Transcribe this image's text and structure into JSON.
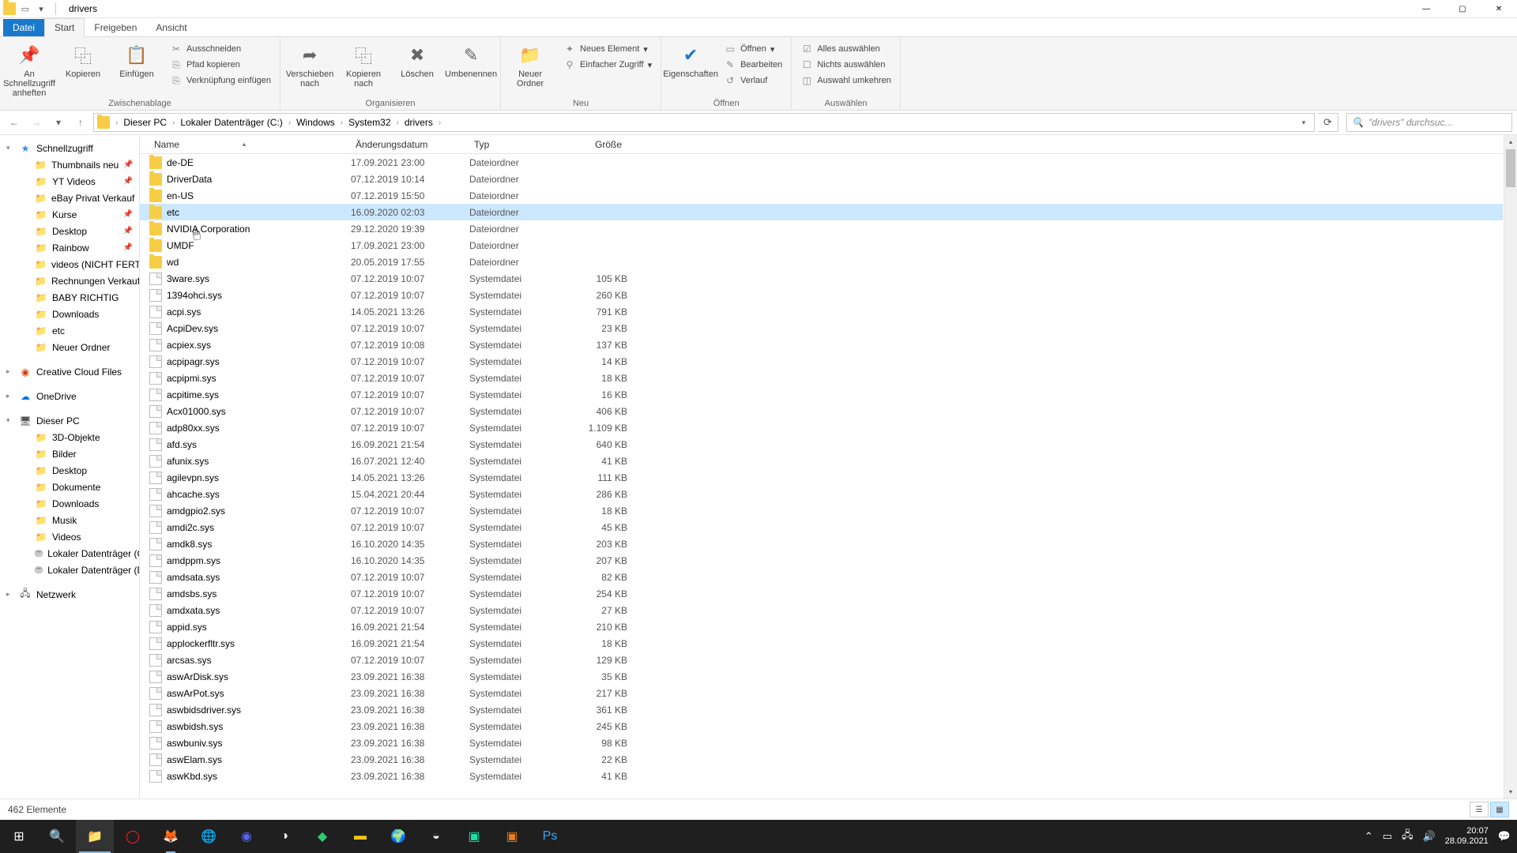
{
  "window": {
    "title": "drivers"
  },
  "tabs": {
    "file": "Datei",
    "start": "Start",
    "share": "Freigeben",
    "view": "Ansicht"
  },
  "ribbon": {
    "pin": "An Schnellzugriff\nanheften",
    "copy": "Kopieren",
    "paste": "Einfügen",
    "cut": "Ausschneiden",
    "copypath": "Pfad kopieren",
    "pastelnk": "Verknüpfung einfügen",
    "group_clipboard": "Zwischenablage",
    "moveto": "Verschieben\nnach",
    "copyto": "Kopieren\nnach",
    "delete": "Löschen",
    "rename": "Umbenennen",
    "group_organize": "Organisieren",
    "newfolder": "Neuer\nOrdner",
    "newitem": "Neues Element",
    "easyaccess": "Einfacher Zugriff",
    "group_new": "Neu",
    "properties": "Eigenschaften",
    "open": "Öffnen",
    "edit": "Bearbeiten",
    "history": "Verlauf",
    "group_open": "Öffnen",
    "selectall": "Alles auswählen",
    "selectnone": "Nichts auswählen",
    "invert": "Auswahl umkehren",
    "group_select": "Auswählen"
  },
  "breadcrumb": [
    "Dieser PC",
    "Lokaler Datenträger (C:)",
    "Windows",
    "System32",
    "drivers"
  ],
  "search_placeholder": "\"drivers\" durchsuc...",
  "sidebar": {
    "quick": "Schnellzugriff",
    "quick_items": [
      {
        "label": "Thumbnails neu",
        "pin": true
      },
      {
        "label": "YT Videos",
        "pin": true
      },
      {
        "label": "eBay Privat Verkauf",
        "pin": true
      },
      {
        "label": "Kurse",
        "pin": true
      },
      {
        "label": "Desktop",
        "pin": true
      },
      {
        "label": "Rainbow",
        "pin": true
      },
      {
        "label": "videos (NICHT FERTIG)",
        "pin": true
      },
      {
        "label": "Rechnungen Verkauf",
        "pin": true
      },
      {
        "label": "BABY RICHTIG",
        "pin": false
      },
      {
        "label": "Downloads",
        "pin": false
      },
      {
        "label": "etc",
        "pin": false
      },
      {
        "label": "Neuer Ordner",
        "pin": false
      }
    ],
    "cc": "Creative Cloud Files",
    "od": "OneDrive",
    "pc": "Dieser PC",
    "pc_items": [
      "3D-Objekte",
      "Bilder",
      "Desktop",
      "Dokumente",
      "Downloads",
      "Musik",
      "Videos",
      "Lokaler Datenträger (C:)",
      "Lokaler Datenträger (D:)"
    ],
    "net": "Netzwerk"
  },
  "columns": {
    "name": "Name",
    "date": "Änderungsdatum",
    "type": "Typ",
    "size": "Größe"
  },
  "files": [
    {
      "n": "de-DE",
      "d": "17.09.2021 23:00",
      "t": "Dateiordner",
      "s": "",
      "f": true
    },
    {
      "n": "DriverData",
      "d": "07.12.2019 10:14",
      "t": "Dateiordner",
      "s": "",
      "f": true
    },
    {
      "n": "en-US",
      "d": "07.12.2019 15:50",
      "t": "Dateiordner",
      "s": "",
      "f": true
    },
    {
      "n": "etc",
      "d": "16.09.2020 02:03",
      "t": "Dateiordner",
      "s": "",
      "f": true,
      "sel": true
    },
    {
      "n": "NVIDIA Corporation",
      "d": "29.12.2020 19:39",
      "t": "Dateiordner",
      "s": "",
      "f": true
    },
    {
      "n": "UMDF",
      "d": "17.09.2021 23:00",
      "t": "Dateiordner",
      "s": "",
      "f": true
    },
    {
      "n": "wd",
      "d": "20.05.2019 17:55",
      "t": "Dateiordner",
      "s": "",
      "f": true
    },
    {
      "n": "3ware.sys",
      "d": "07.12.2019 10:07",
      "t": "Systemdatei",
      "s": "105 KB"
    },
    {
      "n": "1394ohci.sys",
      "d": "07.12.2019 10:07",
      "t": "Systemdatei",
      "s": "260 KB"
    },
    {
      "n": "acpi.sys",
      "d": "14.05.2021 13:26",
      "t": "Systemdatei",
      "s": "791 KB"
    },
    {
      "n": "AcpiDev.sys",
      "d": "07.12.2019 10:07",
      "t": "Systemdatei",
      "s": "23 KB"
    },
    {
      "n": "acpiex.sys",
      "d": "07.12.2019 10:08",
      "t": "Systemdatei",
      "s": "137 KB"
    },
    {
      "n": "acpipagr.sys",
      "d": "07.12.2019 10:07",
      "t": "Systemdatei",
      "s": "14 KB"
    },
    {
      "n": "acpipmi.sys",
      "d": "07.12.2019 10:07",
      "t": "Systemdatei",
      "s": "18 KB"
    },
    {
      "n": "acpitime.sys",
      "d": "07.12.2019 10:07",
      "t": "Systemdatei",
      "s": "16 KB"
    },
    {
      "n": "Acx01000.sys",
      "d": "07.12.2019 10:07",
      "t": "Systemdatei",
      "s": "406 KB"
    },
    {
      "n": "adp80xx.sys",
      "d": "07.12.2019 10:07",
      "t": "Systemdatei",
      "s": "1.109 KB"
    },
    {
      "n": "afd.sys",
      "d": "16.09.2021 21:54",
      "t": "Systemdatei",
      "s": "640 KB"
    },
    {
      "n": "afunix.sys",
      "d": "16.07.2021 12:40",
      "t": "Systemdatei",
      "s": "41 KB"
    },
    {
      "n": "agilevpn.sys",
      "d": "14.05.2021 13:26",
      "t": "Systemdatei",
      "s": "111 KB"
    },
    {
      "n": "ahcache.sys",
      "d": "15.04.2021 20:44",
      "t": "Systemdatei",
      "s": "286 KB"
    },
    {
      "n": "amdgpio2.sys",
      "d": "07.12.2019 10:07",
      "t": "Systemdatei",
      "s": "18 KB"
    },
    {
      "n": "amdi2c.sys",
      "d": "07.12.2019 10:07",
      "t": "Systemdatei",
      "s": "45 KB"
    },
    {
      "n": "amdk8.sys",
      "d": "16.10.2020 14:35",
      "t": "Systemdatei",
      "s": "203 KB"
    },
    {
      "n": "amdppm.sys",
      "d": "16.10.2020 14:35",
      "t": "Systemdatei",
      "s": "207 KB"
    },
    {
      "n": "amdsata.sys",
      "d": "07.12.2019 10:07",
      "t": "Systemdatei",
      "s": "82 KB"
    },
    {
      "n": "amdsbs.sys",
      "d": "07.12.2019 10:07",
      "t": "Systemdatei",
      "s": "254 KB"
    },
    {
      "n": "amdxata.sys",
      "d": "07.12.2019 10:07",
      "t": "Systemdatei",
      "s": "27 KB"
    },
    {
      "n": "appid.sys",
      "d": "16.09.2021 21:54",
      "t": "Systemdatei",
      "s": "210 KB"
    },
    {
      "n": "applockerfltr.sys",
      "d": "16.09.2021 21:54",
      "t": "Systemdatei",
      "s": "18 KB"
    },
    {
      "n": "arcsas.sys",
      "d": "07.12.2019 10:07",
      "t": "Systemdatei",
      "s": "129 KB"
    },
    {
      "n": "aswArDisk.sys",
      "d": "23.09.2021 16:38",
      "t": "Systemdatei",
      "s": "35 KB"
    },
    {
      "n": "aswArPot.sys",
      "d": "23.09.2021 16:38",
      "t": "Systemdatei",
      "s": "217 KB"
    },
    {
      "n": "aswbidsdriver.sys",
      "d": "23.09.2021 16:38",
      "t": "Systemdatei",
      "s": "361 KB"
    },
    {
      "n": "aswbidsh.sys",
      "d": "23.09.2021 16:38",
      "t": "Systemdatei",
      "s": "245 KB"
    },
    {
      "n": "aswbuniv.sys",
      "d": "23.09.2021 16:38",
      "t": "Systemdatei",
      "s": "98 KB"
    },
    {
      "n": "aswElam.sys",
      "d": "23.09.2021 16:38",
      "t": "Systemdatei",
      "s": "22 KB"
    },
    {
      "n": "aswKbd.sys",
      "d": "23.09.2021 16:38",
      "t": "Systemdatei",
      "s": "41 KB"
    }
  ],
  "status": "462 Elemente",
  "tray": {
    "time": "20:07",
    "date": "28.09.2021"
  }
}
